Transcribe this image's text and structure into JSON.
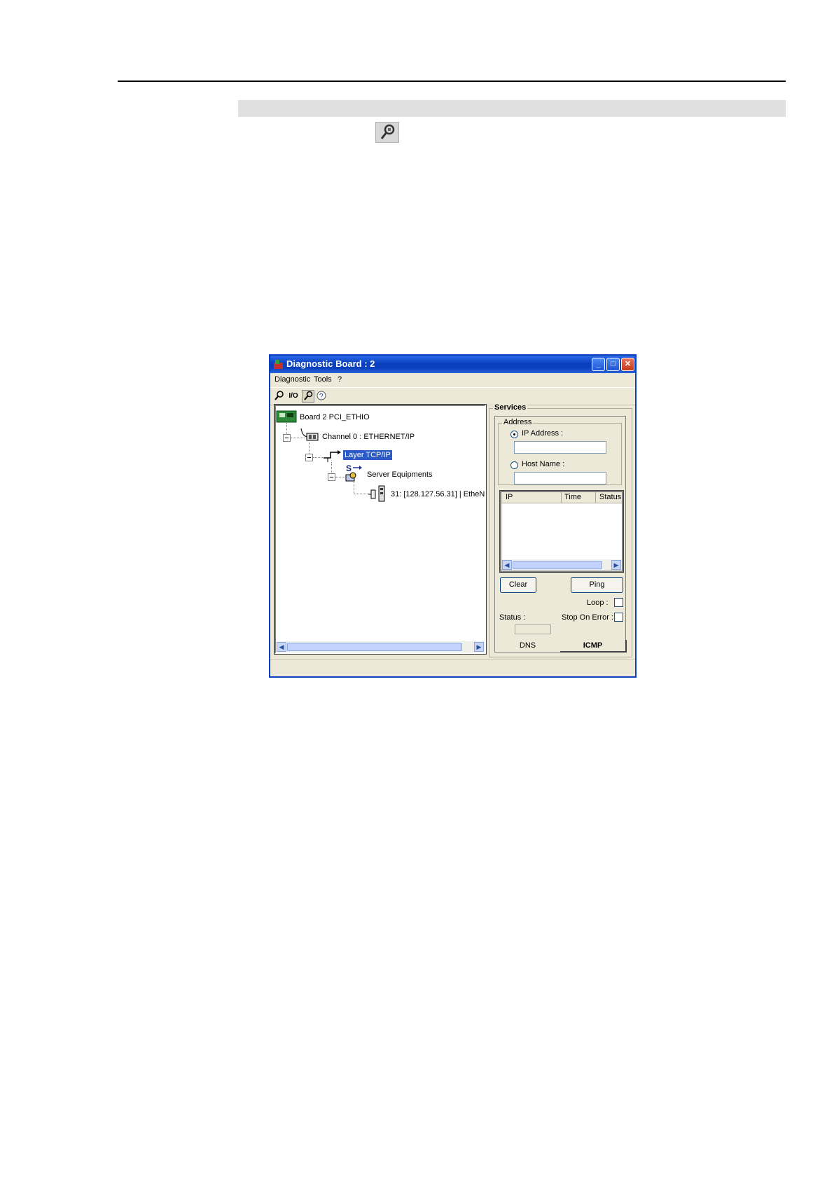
{
  "document": {},
  "window": {
    "title": "Diagnostic Board : 2",
    "buttons": {
      "minimize": "_",
      "maximize": "□",
      "close": "✕"
    },
    "menu": [
      "Diagnostic",
      "Tools",
      "?"
    ],
    "toolbar_icons": [
      "magnifier-icon",
      "io-icon",
      "diagnostic-tool-icon",
      "help-icon"
    ],
    "toolbar_io_label": "I/O"
  },
  "tree": {
    "board": "Board 2 PCI_ETHIO",
    "channel": "Channel 0 : ETHERNET/IP",
    "layer": "Layer TCP/IP",
    "server_badge": "S",
    "server": "Server  Equipments",
    "device": "31: [128.127.56.31] | EtheN"
  },
  "services": {
    "group_label": "Services",
    "address_label": "Address",
    "ip_radio_label": "IP Address :",
    "host_radio_label": "Host Name :",
    "ip_value": "",
    "host_value": "",
    "columns": [
      "IP",
      "Time",
      "Status"
    ],
    "clear_button": "Clear",
    "ping_button": "Ping",
    "loop_label": "Loop :",
    "stop_on_error_label": "Stop On Error :",
    "status_label": "Status :",
    "tabs": [
      "DNS",
      "ICMP"
    ],
    "active_tab": "ICMP"
  },
  "colors": {
    "title_bar": "#0a3fbe",
    "selection": "#2a5bc6",
    "window_bg": "#ece9d8"
  }
}
